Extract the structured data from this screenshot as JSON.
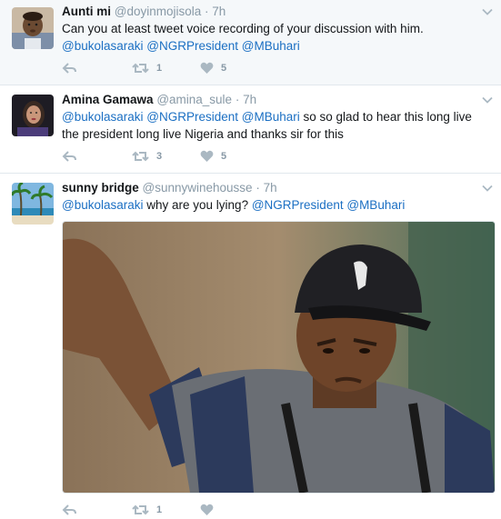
{
  "tweets": [
    {
      "name": "Aunti mi",
      "handle": "@doyinmojisola",
      "separator": "·",
      "time": "7h",
      "text_plain": "Can you at least tweet voice recording of your discussion with him.",
      "mentions": [
        "@bukolasaraki",
        "@NGRPresident",
        "@MBuhari"
      ],
      "retweets": "1",
      "likes": "5"
    },
    {
      "name": "Amina Gamawa",
      "handle": "@amina_sule",
      "separator": "·",
      "time": "7h",
      "mentions": [
        "@bukolasaraki",
        "@NGRPresident",
        "@MBuhari"
      ],
      "text_after": "so so glad to hear this long live the president long live Nigeria and thanks sir for this",
      "retweets": "3",
      "likes": "5"
    },
    {
      "name": "sunny bridge",
      "handle": "@sunnywinehousse",
      "separator": "·",
      "time": "7h",
      "mention_first": "@bukolasaraki",
      "text_middle": "why are you lying?",
      "mentions_after": [
        "@NGRPresident",
        "@MBuhari"
      ],
      "retweets": "1",
      "likes": ""
    }
  ],
  "icons": {
    "reply": "reply-icon",
    "retweet": "retweet-icon",
    "like": "heart-icon",
    "more": "chevron-down-icon"
  },
  "colors": {
    "link": "#1b6fc3",
    "muted": "#8899a6",
    "icon": "#aab8c2",
    "highlight_bg": "#f5f8fa"
  }
}
